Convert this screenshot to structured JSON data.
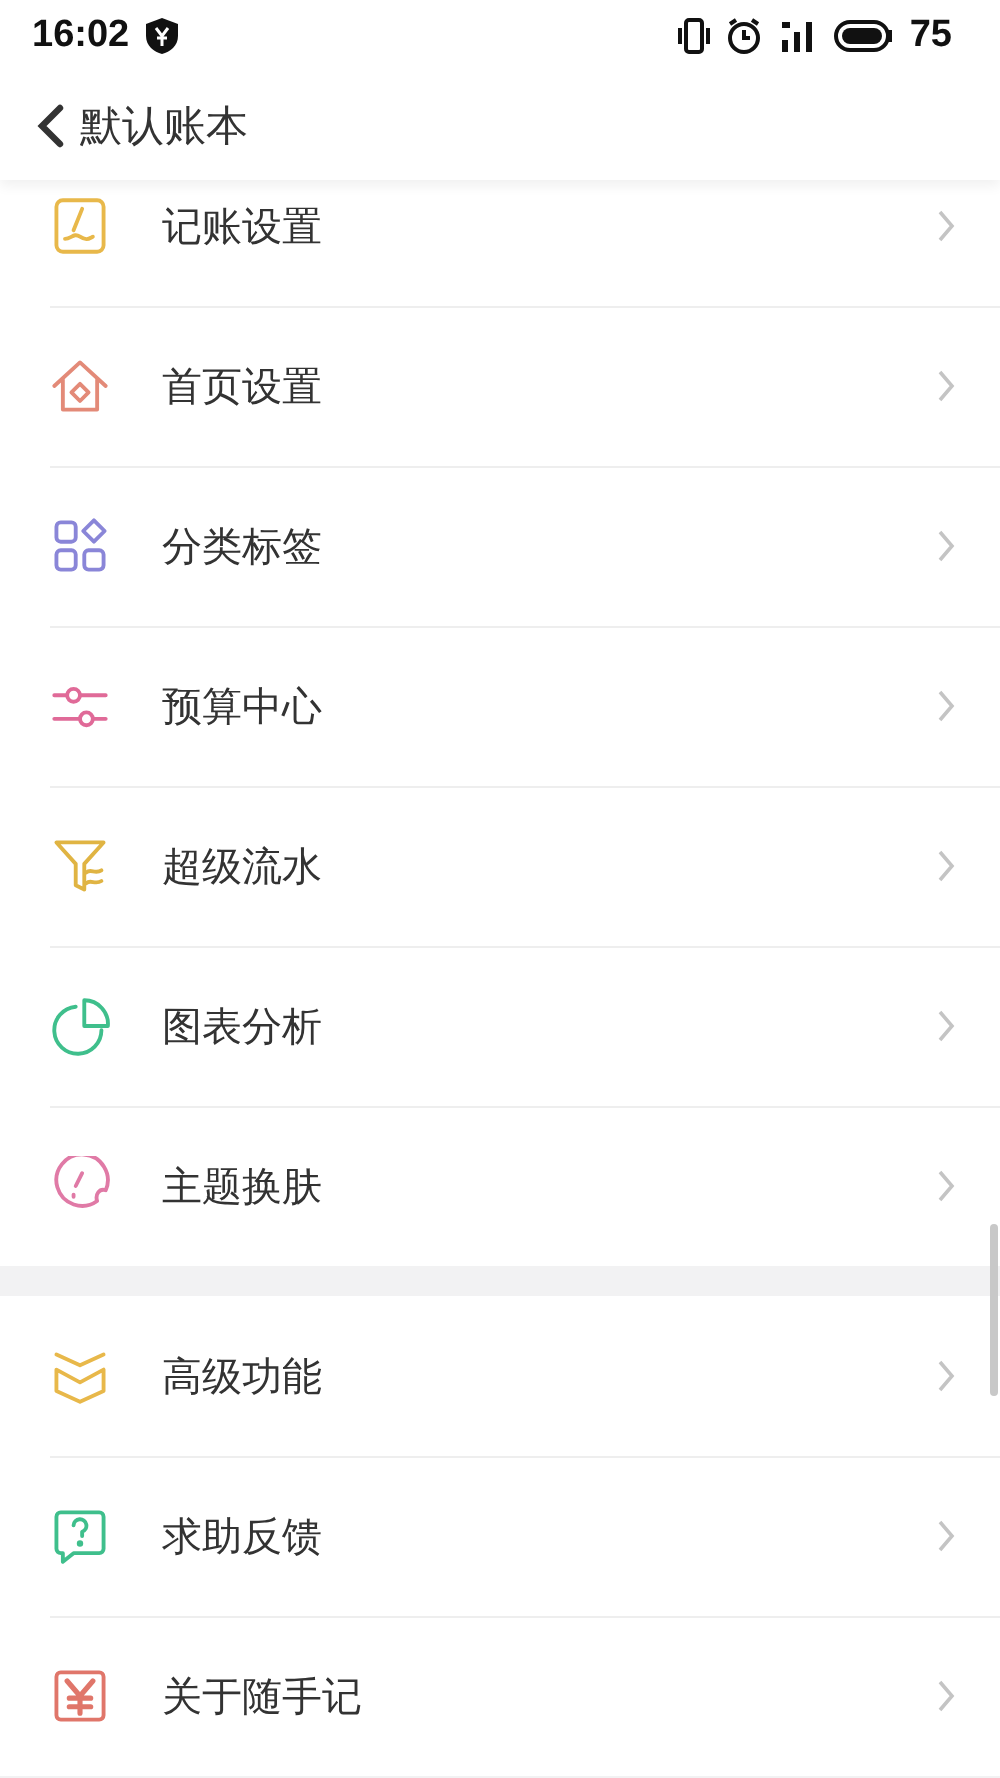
{
  "status_bar": {
    "time": "16:02",
    "battery": "75"
  },
  "header": {
    "title": "默认账本"
  },
  "groups": [
    {
      "items": [
        {
          "kind": "bookkeeping",
          "label": "记账设置"
        },
        {
          "kind": "home",
          "label": "首页设置"
        },
        {
          "kind": "category",
          "label": "分类标签"
        },
        {
          "kind": "budget",
          "label": "预算中心"
        },
        {
          "kind": "flow",
          "label": "超级流水"
        },
        {
          "kind": "chart",
          "label": "图表分析"
        },
        {
          "kind": "theme",
          "label": "主题换肤"
        }
      ]
    },
    {
      "items": [
        {
          "kind": "advanced",
          "label": "高级功能"
        },
        {
          "kind": "help",
          "label": "求助反馈"
        },
        {
          "kind": "about",
          "label": "关于随手记"
        }
      ]
    }
  ]
}
